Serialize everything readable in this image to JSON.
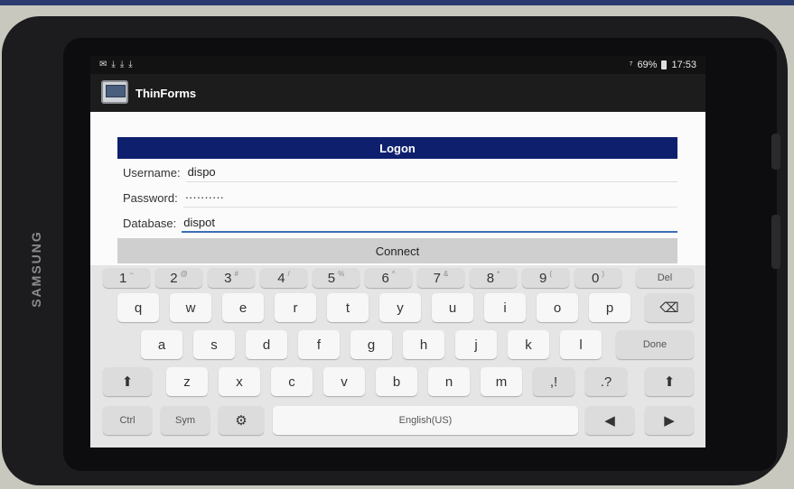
{
  "device": {
    "brand": "SAMSUNG"
  },
  "status_bar": {
    "left_icons": [
      "message-icon",
      "download-icon",
      "download-icon",
      "download-icon"
    ],
    "signal": "⁷",
    "battery": "69%",
    "time": "17:53"
  },
  "app": {
    "title": "ThinForms"
  },
  "logon": {
    "header": "Logon",
    "fields": [
      {
        "label": "Username:",
        "value": "dispo"
      },
      {
        "label": "Password:",
        "value": "··········"
      },
      {
        "label": "Database:",
        "value": "dispot"
      }
    ],
    "connect_label": "Connect"
  },
  "keyboard": {
    "number_row": [
      {
        "main": "1",
        "alt": "~"
      },
      {
        "main": "2",
        "alt": "@"
      },
      {
        "main": "3",
        "alt": "#"
      },
      {
        "main": "4",
        "alt": "/"
      },
      {
        "main": "5",
        "alt": "%"
      },
      {
        "main": "6",
        "alt": "^"
      },
      {
        "main": "7",
        "alt": "&"
      },
      {
        "main": "8",
        "alt": "*"
      },
      {
        "main": "9",
        "alt": "("
      },
      {
        "main": "0",
        "alt": ")"
      }
    ],
    "del": "Del",
    "row1": [
      "q",
      "w",
      "e",
      "r",
      "t",
      "y",
      "u",
      "i",
      "o",
      "p"
    ],
    "row2": [
      "a",
      "s",
      "d",
      "f",
      "g",
      "h",
      "j",
      "k",
      "l"
    ],
    "done": "Done",
    "row3": [
      "z",
      "x",
      "c",
      "v",
      "b",
      "n",
      "m",
      ",!",
      ".?"
    ],
    "ctrl": "Ctrl",
    "sym": "Sym",
    "space": "English(US)"
  }
}
